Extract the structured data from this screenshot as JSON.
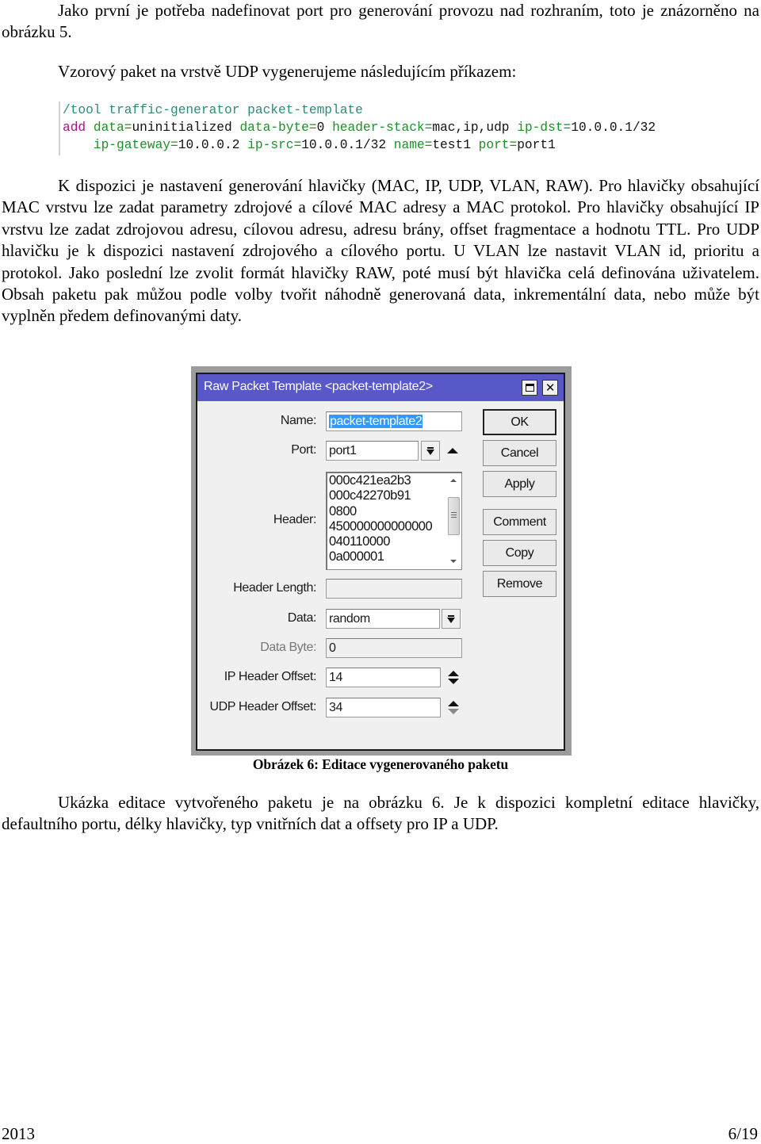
{
  "paragraphs": {
    "p1": "Jako první je potřeba nadefinovat port pro generování provozu nad rozhraním, toto je znázorněno na obrázku 5.",
    "p2": "Vzorový paket na vrstvě UDP vygenerujeme následujícím příkazem:",
    "p3": "K dispozici je nastavení generování hlavičky (MAC, IP, UDP, VLAN, RAW). Pro hlavičky obsahující MAC vrstvu lze zadat parametry zdrojové a cílové MAC adresy a MAC protokol. Pro hlavičky obsahující IP vrstvu lze zadat zdrojovou adresu, cílovou adresu, adresu brány, offset fragmentace a hodnotu TTL. Pro UDP hlavičku je k dispozici nastavení zdrojového a cílového portu. U VLAN lze nastavit VLAN id, prioritu a protokol. Jako poslední lze zvolit formát hlavičky RAW, poté musí být hlavička celá definována uživatelem. Obsah paketu pak můžou podle volby tvořit náhodně generovaná data, inkrementální data, nebo může být vyplněn předem definovanými daty.",
    "p4": "Ukázka editace vytvořeného paketu je na obrázku 6. Je k dispozici kompletní editace hlavičky, defaultního portu, délky hlavičky, typ vnitřních dat a offsety pro IP a UDP."
  },
  "code": {
    "line1_path": "/tool traffic-generator packet-template",
    "cmd": "add",
    "args_line2": [
      {
        "key": "data",
        "value": "uninitialized"
      },
      {
        "key": "data-byte",
        "value": "0"
      },
      {
        "key": "header-stack",
        "value": "mac,ip,udp"
      },
      {
        "key": "ip-dst",
        "value": "10.0.0.1/32"
      }
    ],
    "args_line3": [
      {
        "key": "ip-gateway",
        "value": "10.0.0.2"
      },
      {
        "key": "ip-src",
        "value": "10.0.0.1/32"
      },
      {
        "key": "name",
        "value": "test1"
      },
      {
        "key": "port",
        "value": "port1"
      }
    ],
    "colors": {
      "path": "#2e8b7a",
      "command": "#a4168a",
      "key": "#1f8f2a",
      "value": "#111111"
    }
  },
  "dialog": {
    "title": "Raw Packet Template <packet-template2>",
    "title_bar_color": "#5858c8",
    "maximize_icon": "maximize-icon",
    "close_icon": "close-icon",
    "fields": {
      "name": {
        "label": "Name:",
        "value": "packet-template2"
      },
      "port": {
        "label": "Port:",
        "value": "port1"
      },
      "header": {
        "label": "Header:",
        "lines": [
          "000c421ea2b3",
          "000c42270b91",
          "0800",
          "450000000000000",
          "040110000",
          "0a000001"
        ]
      },
      "header_length": {
        "label": "Header Length:",
        "value": ""
      },
      "data": {
        "label": "Data:",
        "value": "random"
      },
      "data_byte": {
        "label": "Data Byte:",
        "value": "0"
      },
      "ip_header_offset": {
        "label": "IP Header Offset:",
        "value": "14"
      },
      "udp_header_offset": {
        "label": "UDP Header Offset:",
        "value": "34"
      }
    },
    "buttons": {
      "ok": "OK",
      "cancel": "Cancel",
      "apply": "Apply",
      "comment": "Comment",
      "copy": "Copy",
      "remove": "Remove"
    }
  },
  "caption": "Obrázek 6: Editace vygenerovaného paketu",
  "footer": {
    "year": "2013",
    "page": "6/19"
  }
}
